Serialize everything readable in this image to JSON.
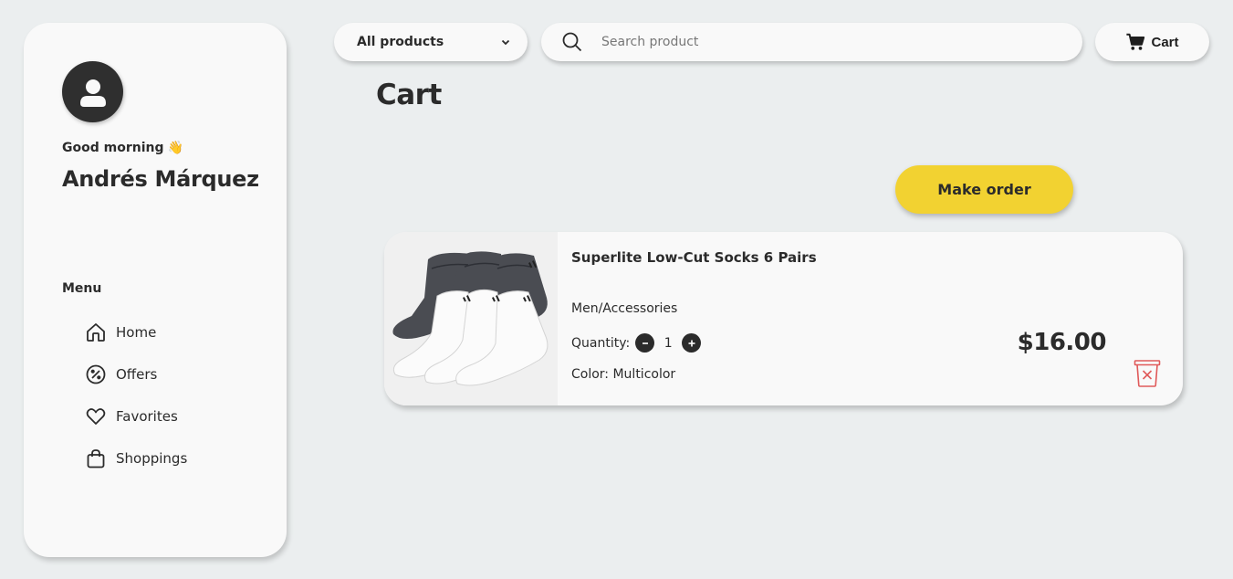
{
  "sidebar": {
    "greeting": "Good morning",
    "greeting_emoji": "👋",
    "user_name": "Andrés Márquez",
    "menu_heading": "Menu",
    "items": [
      {
        "label": "Home",
        "icon": "home-icon"
      },
      {
        "label": "Offers",
        "icon": "percent-icon"
      },
      {
        "label": "Favorites",
        "icon": "heart-icon"
      },
      {
        "label": "Shoppings",
        "icon": "shopping-bag-icon"
      }
    ]
  },
  "topbar": {
    "filter_selected": "All products",
    "search_placeholder": "Search product",
    "cart_label": "Cart"
  },
  "main": {
    "title": "Cart",
    "make_order_label": "Make order"
  },
  "cart_items": [
    {
      "name": "Superlite Low-Cut Socks 6 Pairs",
      "category": "Men/Accessories",
      "quantity_label": "Quantity:",
      "quantity": "1",
      "color_label": "Color: Multicolor",
      "price": "$16.00"
    }
  ],
  "colors": {
    "background": "#ebeeef",
    "panel": "#f9f9f9",
    "accent": "#f2d231",
    "text": "#2b2b2b",
    "delete": "#e05a5a"
  }
}
